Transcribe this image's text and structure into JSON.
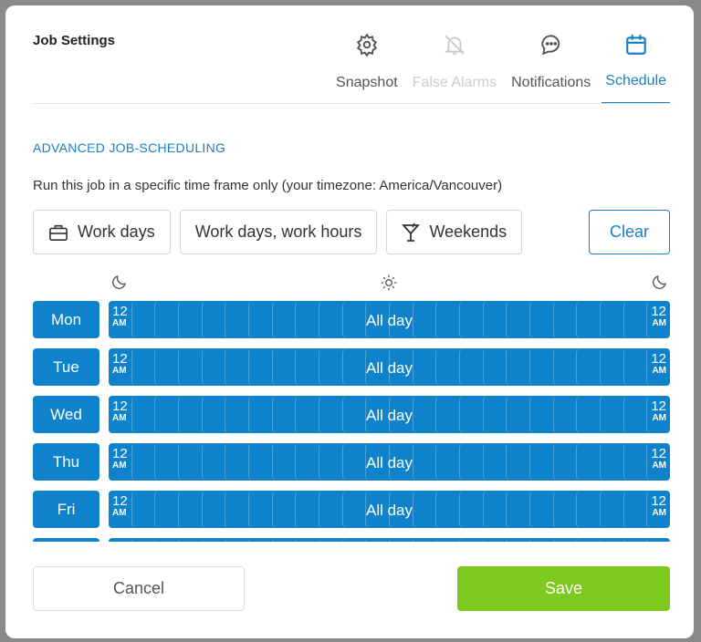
{
  "title": "Job Settings",
  "tabs": [
    {
      "label": "Snapshot",
      "icon": "gear-icon",
      "state": "normal"
    },
    {
      "label": "False Alarms",
      "icon": "bell-off-icon",
      "state": "disabled"
    },
    {
      "label": "Notifications",
      "icon": "chat-bubble-icon",
      "state": "normal"
    },
    {
      "label": "Schedule",
      "icon": "calendar-icon",
      "state": "active"
    }
  ],
  "section_title": "ADVANCED JOB-SCHEDULING",
  "description": "Run this job in a specific time frame only (your timezone: America/Vancouver)",
  "presets": [
    {
      "label": "Work days",
      "icon": "briefcase-icon"
    },
    {
      "label": "Work days, work hours",
      "icon": ""
    },
    {
      "label": "Weekends",
      "icon": "cocktail-icon"
    }
  ],
  "clear_label": "Clear",
  "time_start": "12",
  "time_end": "12",
  "ampm": "AM",
  "days": [
    {
      "label": "Mon",
      "summary": "All day"
    },
    {
      "label": "Tue",
      "summary": "All day"
    },
    {
      "label": "Wed",
      "summary": "All day"
    },
    {
      "label": "Thu",
      "summary": "All day"
    },
    {
      "label": "Fri",
      "summary": "All day"
    },
    {
      "label": "",
      "summary": ""
    }
  ],
  "colors": {
    "accent": "#1a7fc1",
    "selected": "#0e83cc",
    "save": "#7ec91e"
  },
  "cancel_label": "Cancel",
  "save_label": "Save"
}
